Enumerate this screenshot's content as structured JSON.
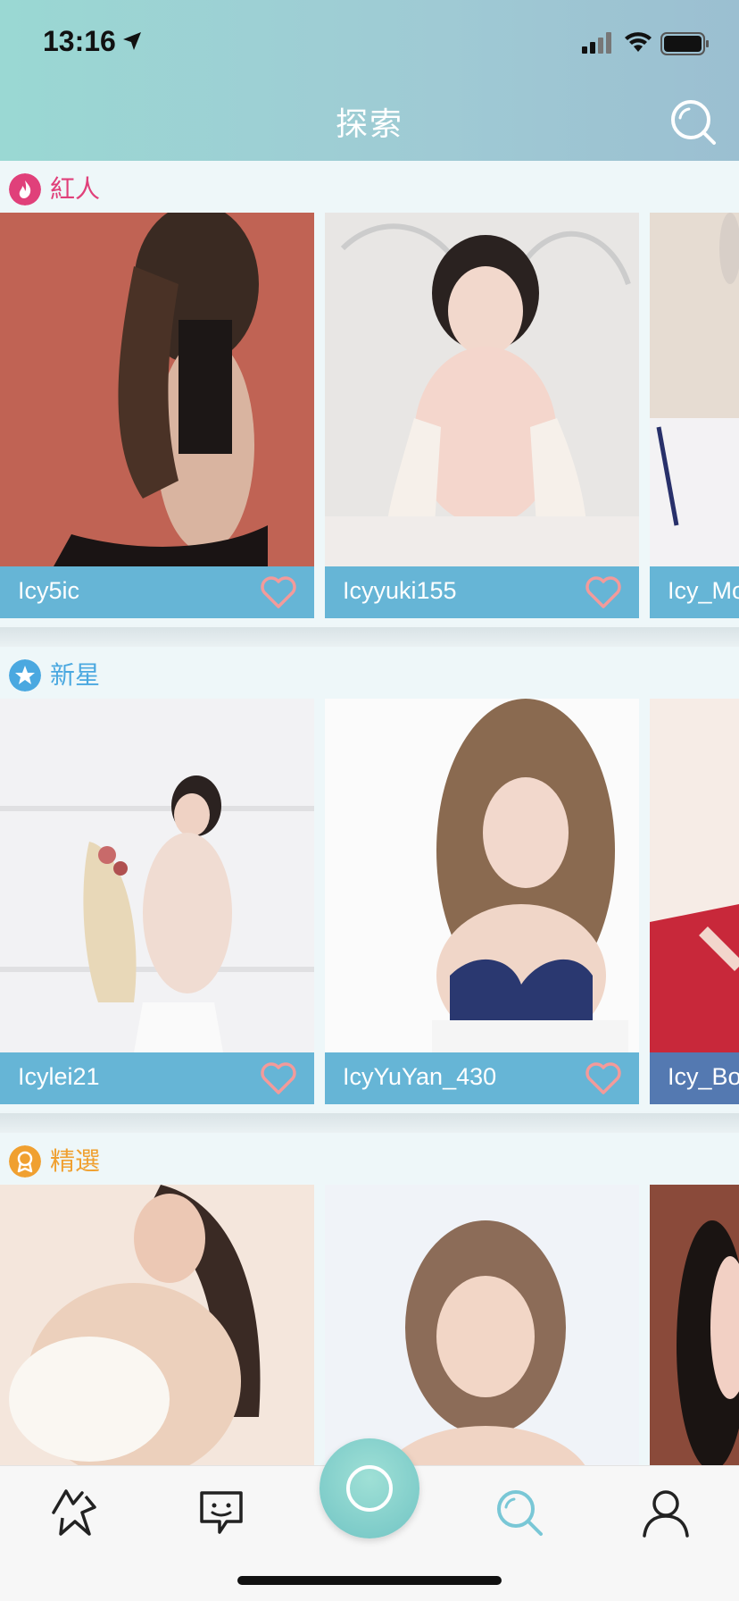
{
  "status_bar": {
    "time": "13:16"
  },
  "header": {
    "title": "探索"
  },
  "icons": {
    "search": "search-icon",
    "location": "location-arrow-icon",
    "heart": "heart-icon"
  },
  "colors": {
    "hot": "#e0407a",
    "new": "#4aa8e0",
    "featured": "#f0a030",
    "name_bar": "#5aafd2",
    "heart": "#f39a9a",
    "tab_active": "#79c7d6"
  },
  "sections": [
    {
      "label": "紅人",
      "icon": "fire-icon",
      "cards": [
        {
          "name": "Icy5ic"
        },
        {
          "name": "Icyyuki155"
        },
        {
          "name": "Icy_Mo"
        }
      ]
    },
    {
      "label": "新星",
      "icon": "star-icon",
      "cards": [
        {
          "name": "Icylei21"
        },
        {
          "name": "IcyYuYan_430"
        },
        {
          "name": "Icy_Bo"
        }
      ]
    },
    {
      "label": "精選",
      "icon": "award-icon",
      "cards": [
        {
          "name": ""
        },
        {
          "name": ""
        },
        {
          "name": ""
        }
      ]
    }
  ],
  "tabbar": {
    "items": [
      {
        "icon": "trending-icon"
      },
      {
        "icon": "chat-icon"
      },
      {
        "icon": "live-button-icon"
      },
      {
        "icon": "explore-icon",
        "active": true
      },
      {
        "icon": "profile-icon"
      }
    ]
  }
}
